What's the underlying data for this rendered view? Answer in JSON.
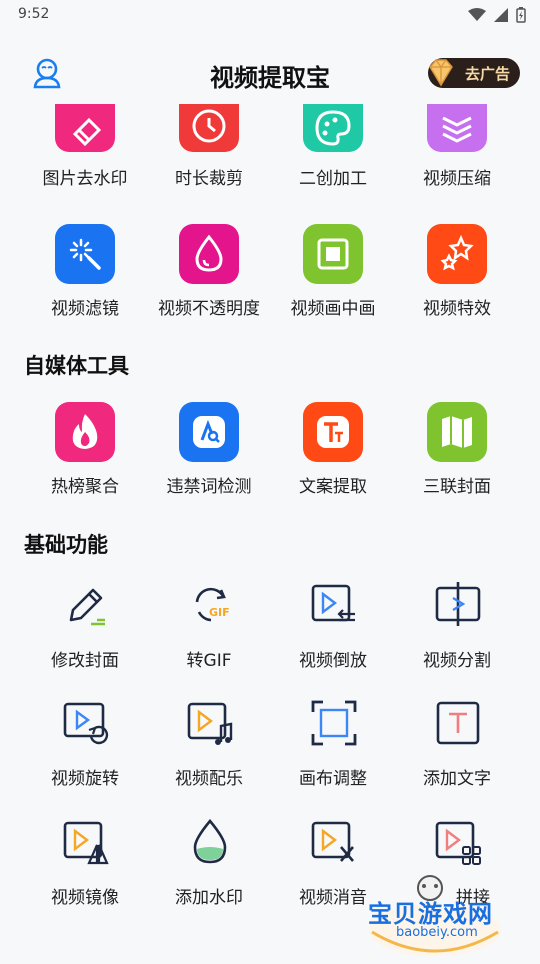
{
  "status": {
    "time": "9:52"
  },
  "header": {
    "title": "视频提取宝",
    "vip_label": "去广告"
  },
  "row_partial": [
    {
      "label": "图片去水印",
      "color": "#f0287e",
      "icon": "eraser-icon"
    },
    {
      "label": "时长裁剪",
      "color": "#f03a3a",
      "icon": "clock-icon"
    },
    {
      "label": "二创加工",
      "color": "#20c9a6",
      "icon": "palette-icon"
    },
    {
      "label": "视频压缩",
      "color": "#c670ef",
      "icon": "layers-icon"
    }
  ],
  "row_video": [
    {
      "label": "视频滤镜",
      "color": "#1a73f0",
      "icon": "magic-wand-icon"
    },
    {
      "label": "视频不透明度",
      "color": "#e4148c",
      "icon": "drop-icon"
    },
    {
      "label": "视频画中画",
      "color": "#7fc42e",
      "icon": "picture-in-picture-icon"
    },
    {
      "label": "视频特效",
      "color": "#ff4a16",
      "icon": "stars-icon"
    }
  ],
  "sections": {
    "media_tools": "自媒体工具",
    "basic": "基础功能"
  },
  "row_media": [
    {
      "label": "热榜聚合",
      "color": "#f0287e",
      "icon": "flame-icon"
    },
    {
      "label": "违禁词检测",
      "color": "#1a73f0",
      "icon": "search-text-icon"
    },
    {
      "label": "文案提取",
      "color": "#ff4a16",
      "icon": "text-extract-icon"
    },
    {
      "label": "三联封面",
      "color": "#7fc42e",
      "icon": "map-icon"
    }
  ],
  "basic_items": [
    {
      "label": "修改封面",
      "icon": "pen-icon"
    },
    {
      "label": "转GIF",
      "icon": "gif-icon",
      "gif_text": "GIF"
    },
    {
      "label": "视频倒放",
      "icon": "video-reverse-icon"
    },
    {
      "label": "视频分割",
      "icon": "video-split-icon"
    },
    {
      "label": "视频旋转",
      "icon": "video-rotate-icon"
    },
    {
      "label": "视频配乐",
      "icon": "video-music-icon"
    },
    {
      "label": "画布调整",
      "icon": "canvas-crop-icon"
    },
    {
      "label": "添加文字",
      "icon": "add-text-icon",
      "text_glyph": "T"
    },
    {
      "label": "视频镜像",
      "icon": "video-mirror-icon"
    },
    {
      "label": "添加水印",
      "icon": "watermark-drop-icon"
    },
    {
      "label": "视频消音",
      "icon": "video-mute-icon"
    },
    {
      "label": "拼接",
      "icon": "video-concat-icon"
    }
  ],
  "watermark": {
    "text": "宝贝游戏网",
    "url": "baobeiy.com"
  },
  "accent_line_color": "#1f2a44",
  "accent_orange": "#f5a623",
  "accent_blue": "#3d86f5"
}
